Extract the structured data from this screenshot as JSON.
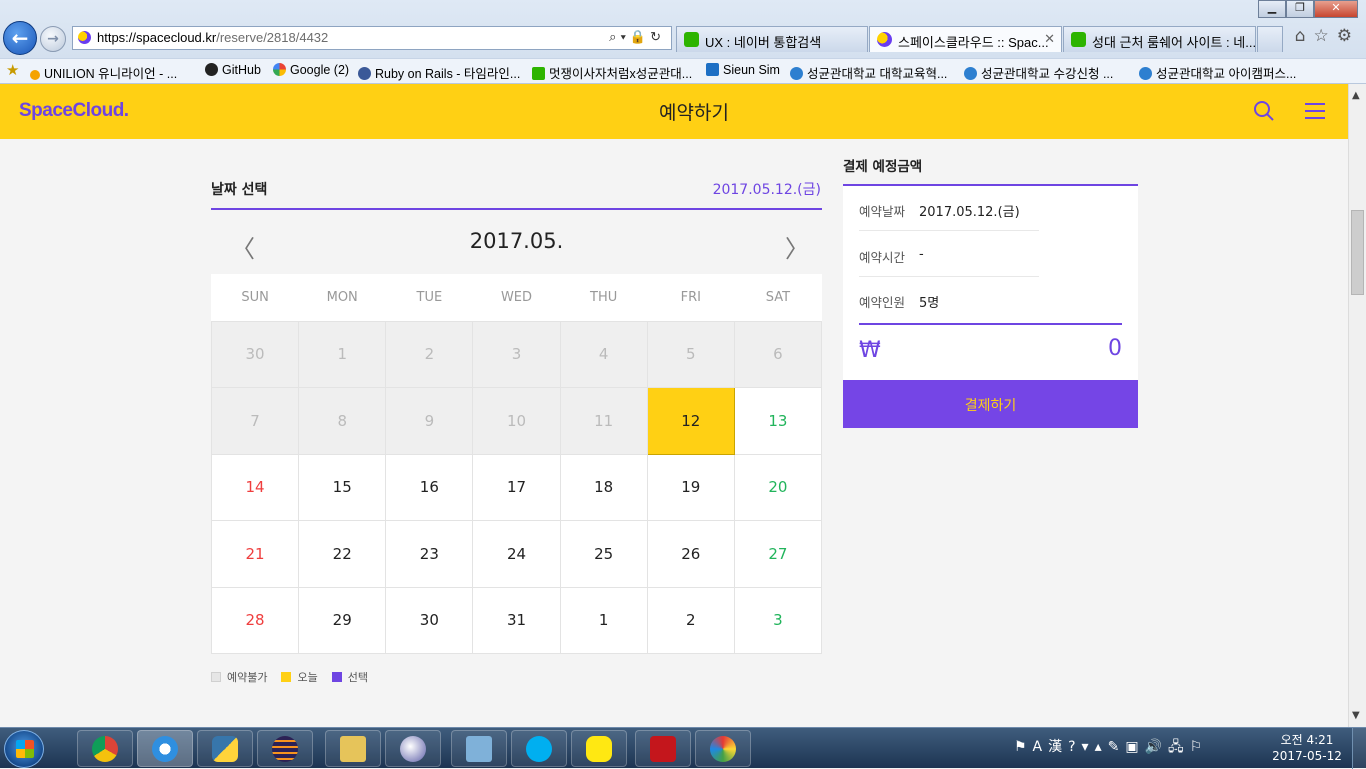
{
  "browser": {
    "url_host": "https://spacecloud.kr",
    "url_path": "/reserve/2818/4432",
    "tabs": [
      {
        "label": "UX : 네이버 통합검색"
      },
      {
        "label": "스페이스클라우드 :: Spac..."
      },
      {
        "label": "성대 근처 룸쉐어 사이트 : 네..."
      }
    ],
    "favorites": [
      {
        "label": "UNILION  유니라이언 - ..."
      },
      {
        "label": "GitHub"
      },
      {
        "label": "Google (2)"
      },
      {
        "label": "Ruby on Rails - 타임라인..."
      },
      {
        "label": "멋쟁이사자처럼x성균관대..."
      },
      {
        "label": "Sieun Sim"
      },
      {
        "label": "성균관대학교 대학교육혁..."
      },
      {
        "label": "성균관대학교 수강신청 ..."
      },
      {
        "label": "성균관대학교 아이캠퍼스..."
      }
    ]
  },
  "header": {
    "logo": "SpaceCloud.",
    "title": "예약하기",
    "brand_color": "#ffd014",
    "accent_color": "#6e45e2"
  },
  "calendar": {
    "section_title": "날짜 선택",
    "selected_date": "2017.05.12.(금)",
    "month": "2017.05.",
    "weekdays": [
      "SUN",
      "MON",
      "TUE",
      "WED",
      "THU",
      "FRI",
      "SAT"
    ],
    "weeks": [
      [
        {
          "d": "30",
          "s": "disabled"
        },
        {
          "d": "1",
          "s": "disabled"
        },
        {
          "d": "2",
          "s": "disabled"
        },
        {
          "d": "3",
          "s": "disabled"
        },
        {
          "d": "4",
          "s": "disabled"
        },
        {
          "d": "5",
          "s": "disabled"
        },
        {
          "d": "6",
          "s": "disabled"
        }
      ],
      [
        {
          "d": "7",
          "s": "disabled"
        },
        {
          "d": "8",
          "s": "disabled"
        },
        {
          "d": "9",
          "s": "disabled"
        },
        {
          "d": "10",
          "s": "disabled"
        },
        {
          "d": "11",
          "s": "disabled"
        },
        {
          "d": "12",
          "s": "today"
        },
        {
          "d": "13",
          "s": "sat"
        }
      ],
      [
        {
          "d": "14",
          "s": "sun"
        },
        {
          "d": "15",
          "s": ""
        },
        {
          "d": "16",
          "s": ""
        },
        {
          "d": "17",
          "s": ""
        },
        {
          "d": "18",
          "s": ""
        },
        {
          "d": "19",
          "s": ""
        },
        {
          "d": "20",
          "s": "sat"
        }
      ],
      [
        {
          "d": "21",
          "s": "sun"
        },
        {
          "d": "22",
          "s": ""
        },
        {
          "d": "23",
          "s": ""
        },
        {
          "d": "24",
          "s": ""
        },
        {
          "d": "25",
          "s": ""
        },
        {
          "d": "26",
          "s": ""
        },
        {
          "d": "27",
          "s": "sat"
        }
      ],
      [
        {
          "d": "28",
          "s": "sun"
        },
        {
          "d": "29",
          "s": ""
        },
        {
          "d": "30",
          "s": ""
        },
        {
          "d": "31",
          "s": ""
        },
        {
          "d": "1",
          "s": ""
        },
        {
          "d": "2",
          "s": ""
        },
        {
          "d": "3",
          "s": "sat"
        }
      ]
    ],
    "legend": [
      {
        "label": "예약불가",
        "color": "#e6e6e6"
      },
      {
        "label": "오늘",
        "color": "#ffd014"
      },
      {
        "label": "선택",
        "color": "#6e45e2"
      }
    ]
  },
  "payment": {
    "title": "결제 예정금액",
    "rows": [
      {
        "key": "예약날짜",
        "value": "2017.05.12.(금)"
      },
      {
        "key": "예약시간",
        "value": "-"
      },
      {
        "key": "예약인원",
        "value": "5명"
      }
    ],
    "currency": "₩",
    "total": "0",
    "button": "결제하기"
  },
  "taskbar": {
    "clock_time": "오전 4:21",
    "clock_date": "2017-05-12"
  }
}
